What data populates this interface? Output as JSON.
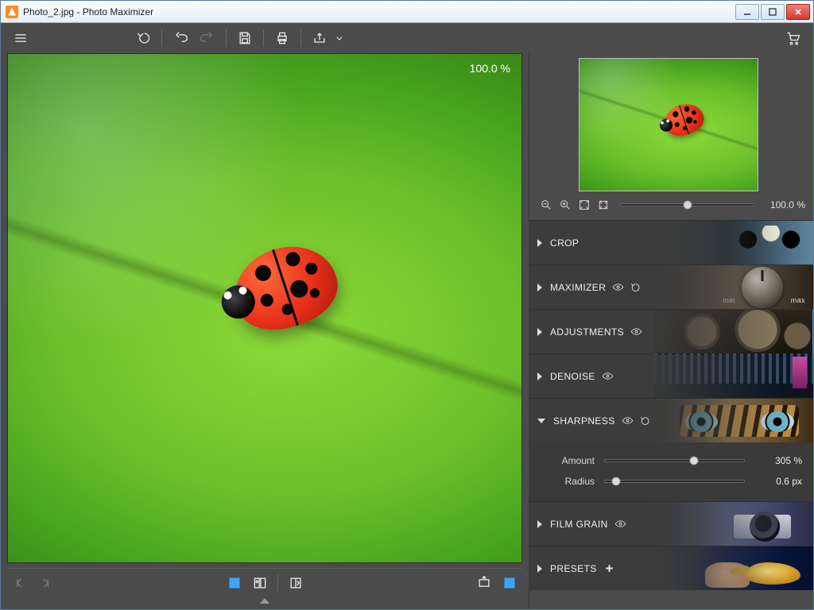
{
  "window": {
    "title": "Photo_2.jpg - Photo Maximizer"
  },
  "canvas": {
    "zoom_label": "100.0 %"
  },
  "navigator": {
    "zoom_label": "100.0 %",
    "slider_percent": 50
  },
  "panels": {
    "crop": {
      "label": "CROP"
    },
    "maximizer": {
      "label": "MAXIMIZER",
      "min": "min",
      "max": "max"
    },
    "adjustments": {
      "label": "ADJUSTMENTS"
    },
    "denoise": {
      "label": "DENOISE"
    },
    "sharpness": {
      "label": "SHARPNESS",
      "amount": {
        "label": "Amount",
        "value": "305 %",
        "percent": 64
      },
      "radius": {
        "label": "Radius",
        "value": "0.6 px",
        "percent": 8
      }
    },
    "filmgrain": {
      "label": "FILM GRAIN"
    },
    "presets": {
      "label": "PRESETS"
    }
  }
}
